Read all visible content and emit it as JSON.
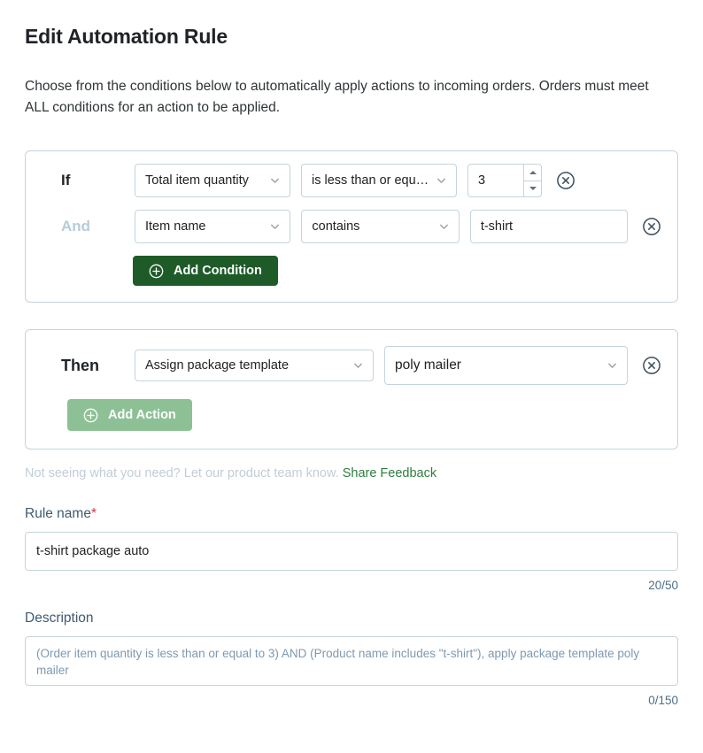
{
  "header": {
    "title": "Edit Automation Rule",
    "subtitle": "Choose from the conditions below to automatically apply actions to incoming orders. Orders must meet ALL conditions for an action to be applied."
  },
  "if_card": {
    "rows": [
      {
        "conjunction": "If",
        "field": "Total item quantity",
        "operator": "is less than or equ…",
        "value": "3",
        "value_type": "number",
        "remove_icon": "circle-x-icon"
      },
      {
        "conjunction": "And",
        "field": "Item name",
        "operator": "contains",
        "value": "t-shirt",
        "value_type": "text",
        "remove_icon": "circle-x-icon"
      }
    ],
    "add_condition_label": "Add Condition",
    "add_condition_icon": "circle-plus-icon"
  },
  "then_card": {
    "conjunction": "Then",
    "action": "Assign package template",
    "action_value": "poly mailer",
    "remove_icon": "circle-x-icon",
    "add_action_label": "Add Action",
    "add_action_icon": "circle-plus-icon"
  },
  "feedback": {
    "text": "Not seeing what you need? Let our product team know.",
    "link_label": "Share Feedback"
  },
  "rule_name": {
    "label": "Rule name",
    "required_marker": "*",
    "value": "t-shirt package auto",
    "counter": "20/50"
  },
  "description": {
    "label": "Description",
    "placeholder": "(Order item quantity is less than or equal to 3) AND (Product name includes \"t-shirt\"), apply package template poly mailer",
    "counter": "0/150"
  },
  "colors": {
    "primary_green": "#1e5b29",
    "muted_green": "#8dc195",
    "link_green": "#2e7d3d",
    "border": "#c3d4de",
    "required_red": "#d2344a",
    "and_label": "#b6ccd9",
    "label_blue": "#3f5a72"
  }
}
